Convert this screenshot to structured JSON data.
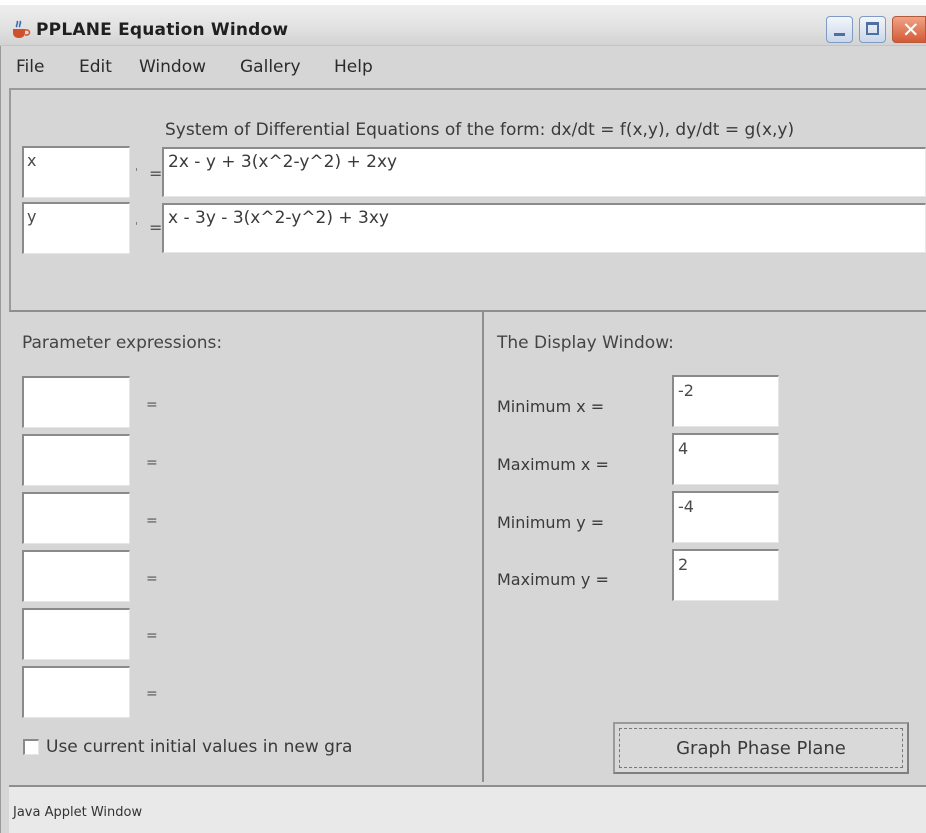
{
  "window": {
    "title": "PPLANE Equation Window",
    "icon": "java-coffee-cup-icon"
  },
  "menu": {
    "items": [
      "File",
      "Edit",
      "Window",
      "Gallery",
      "Help"
    ]
  },
  "equations": {
    "caption": "System of Differential Equations of the form: dx/dt = f(x,y), dy/dt = g(x,y)",
    "rows": [
      {
        "variable": "x",
        "prime": "'",
        "equals": "=",
        "expression": "2x - y + 3(x^2-y^2) + 2xy"
      },
      {
        "variable": "y",
        "prime": "'",
        "equals": "=",
        "expression": "x - 3y - 3(x^2-y^2) + 3xy"
      }
    ]
  },
  "parameters": {
    "title": "Parameter expressions:",
    "separator": "=",
    "fields": [
      "",
      "",
      "",
      "",
      "",
      ""
    ]
  },
  "display_window": {
    "title": "The Display Window:",
    "rows": [
      {
        "label": "Minimum x =",
        "value": "-2"
      },
      {
        "label": "Maximum x =",
        "value": "4"
      },
      {
        "label": "Minimum y =",
        "value": "-4"
      },
      {
        "label": "Maximum y =",
        "value": "2"
      }
    ]
  },
  "options": {
    "use_initial_values_label": "Use current initial values in new gra",
    "use_initial_values_checked": false
  },
  "actions": {
    "graph_label": "Graph Phase Plane"
  },
  "status": {
    "text": "Java Applet Window"
  }
}
